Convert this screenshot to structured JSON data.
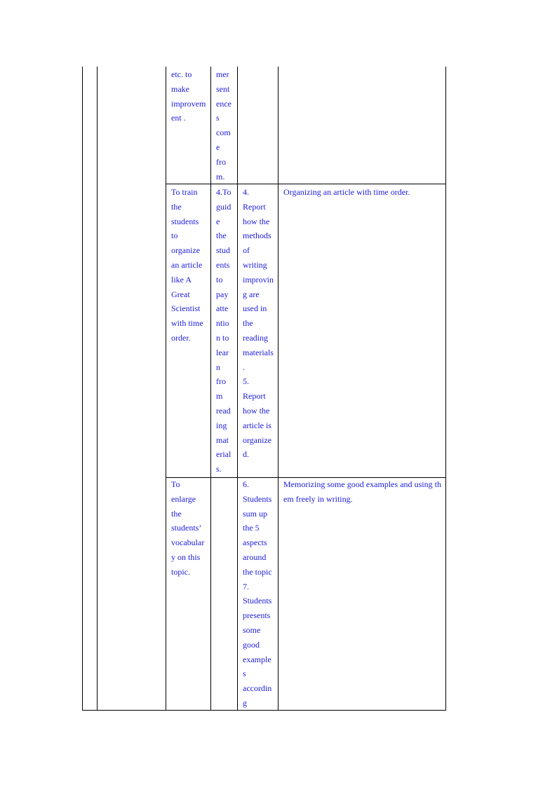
{
  "table": {
    "rows": [
      {
        "objective": "etc. to\nmake\nimprovem\nent .",
        "step": "mer\nsent\nence\ns\ncom\ne\nfro\nm.",
        "activity": "",
        "outcome": ""
      },
      {
        "objective": "To train\nthe\nstudents\nto\norganize\nan article\nlike A\nGreat\nScientist\nwith time\norder.",
        "step": "4.To\nguid\ne\nthe\nstud\nents\nto\npay\natte\nntio\nn to\nlear\nn\nfro\nm\nread\ning\nmat\nerial\ns.",
        "activity": "4.\nReport\nhow the\nmethods\nof\nwriting\nimprovin\ng are\nused in\nthe\nreading\nmaterials\n.\n5.\nReport\nhow the\narticle is\norganize\nd.",
        "outcome": "Organizing an article with time order."
      },
      {
        "objective": "To\nenlarge\nthe\nstudents’\nvocabular\ny on this\ntopic.",
        "step": "",
        "activity": "6.\nStudents\nsum up\nthe 5\naspects\naround\nthe topic\n7.\nStudents\npresents\nsome\ngood\nexample\ns\naccordin\ng",
        "outcome": "Memorizing some good examples and using them freely in writing."
      }
    ]
  }
}
